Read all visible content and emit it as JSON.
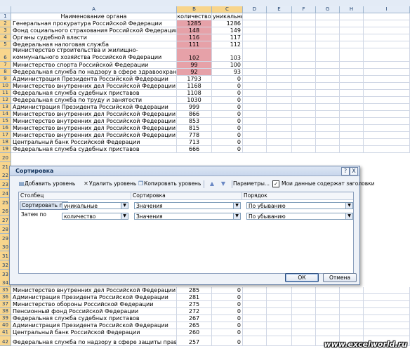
{
  "columns": [
    "A",
    "B",
    "C",
    "D",
    "E",
    "F",
    "G",
    "H",
    "I"
  ],
  "header_row": {
    "num": "1",
    "a": "Наименование органа",
    "b": "количество",
    "c": "уникальные"
  },
  "rows_top": [
    {
      "num": "2",
      "a": "Генеральная прокуратура Российской Федерации",
      "b": "1285",
      "c": "1286",
      "pink": true
    },
    {
      "num": "3",
      "a": "Фонд социального страхования Российской Федерации",
      "b": "148",
      "c": "149",
      "pink": true
    },
    {
      "num": "4",
      "a": "Органы судебной власти",
      "b": "116",
      "c": "117",
      "pink": true
    },
    {
      "num": "5",
      "a": "Федеральная налоговая служба",
      "b": "111",
      "c": "112",
      "pink": true
    },
    {
      "num": "6",
      "a": "Министерство строительства и жилищно-коммунального хозяйства Российской Федерации",
      "b": "102",
      "c": "103",
      "pink": true,
      "tall": true
    },
    {
      "num": "7",
      "a": "Министерство спорта Российской Федерации",
      "b": "99",
      "c": "100",
      "pink": true
    },
    {
      "num": "8",
      "a": "Федеральная служба по надзору в сфере здравоохранения",
      "b": "92",
      "c": "93",
      "pink": true
    },
    {
      "num": "9",
      "a": "Администрация Президента Российской Федерации",
      "b": "1793",
      "c": "0"
    },
    {
      "num": "10",
      "a": "Министерство внутренних дел Российской Федерации",
      "b": "1168",
      "c": "0"
    },
    {
      "num": "11",
      "a": "Федеральная служба судебных приставов",
      "b": "1108",
      "c": "0"
    },
    {
      "num": "12",
      "a": "Федеральная служба по труду и занятости",
      "b": "1030",
      "c": "0"
    },
    {
      "num": "13",
      "a": "Администрация Президента Российской Федерации",
      "b": "999",
      "c": "0"
    },
    {
      "num": "14",
      "a": "Министерство внутренних дел Российской Федерации",
      "b": "866",
      "c": "0"
    },
    {
      "num": "15",
      "a": "Министерство внутренних дел Российской Федерации",
      "b": "853",
      "c": "0"
    },
    {
      "num": "16",
      "a": "Министерство внутренних дел Российской Федерации",
      "b": "815",
      "c": "0"
    },
    {
      "num": "17",
      "a": "Министерство внутренних дел Российской Федерации",
      "b": "778",
      "c": "0"
    },
    {
      "num": "18",
      "a": "Центральный банк Российской Федерации",
      "b": "713",
      "c": "0"
    },
    {
      "num": "19",
      "a": "Федеральная служба судебных приставов",
      "b": "666",
      "c": "0"
    }
  ],
  "hidden_row_numbers": [
    "20",
    "21",
    "22",
    "23",
    "24",
    "25",
    "26",
    "27",
    "28",
    "29",
    "30",
    "31",
    "32",
    "33",
    "34"
  ],
  "rows_bottom": [
    {
      "num": "35",
      "a": "Министерство внутренних дел Российской Федерации",
      "b": "285",
      "c": "0"
    },
    {
      "num": "36",
      "a": "Администрация Президента Российской Федерации",
      "b": "281",
      "c": "0"
    },
    {
      "num": "37",
      "a": "Министерство обороны Российской Федерации",
      "b": "275",
      "c": "0"
    },
    {
      "num": "38",
      "a": "Пенсионный фонд Российской Федерации",
      "b": "272",
      "c": "0"
    },
    {
      "num": "39",
      "a": "Федеральная служба судебных приставов",
      "b": "267",
      "c": "0"
    },
    {
      "num": "40",
      "a": "Администрация Президента Российской Федерации",
      "b": "265",
      "c": "0"
    },
    {
      "num": "41",
      "a": "Центральный банк Российской Федерации",
      "b": "260",
      "c": "0"
    },
    {
      "num": "42",
      "a": "Федеральная служба по надзору в сфере защиты прав",
      "b": "257",
      "c": "0"
    }
  ],
  "dialog": {
    "title": "Сортировка",
    "help": "?",
    "close": "X",
    "toolbar": {
      "add_level": "Добавить уровень",
      "delete_level": "Удалить уровень",
      "copy_level": "Копировать уровень",
      "params": "Параметры...",
      "headers_checkbox": "Мои данные содержат заголовки",
      "headers_checked": true
    },
    "col_headers": {
      "column": "Столбец",
      "sort_on": "Сортировка",
      "order": "Порядок"
    },
    "levels": [
      {
        "label": "Сортировать по",
        "column": "уникальные",
        "sort_on": "Значения",
        "order": "По убыванию"
      },
      {
        "label": "Затем по",
        "column": "количество",
        "sort_on": "Значения",
        "order": "По убыванию"
      }
    ],
    "ok": "ОК",
    "cancel": "Отмена"
  },
  "watermark": "www.excelworld.ru",
  "colors": {
    "highlight": "#e6a1a8",
    "dialog_bg": "#eef2f8",
    "header_bg": "#e4ecf7"
  }
}
